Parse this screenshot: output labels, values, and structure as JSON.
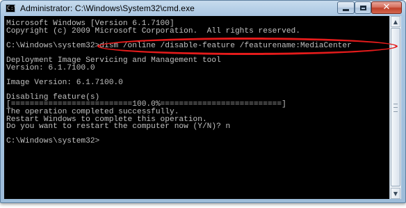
{
  "window": {
    "title": "Administrator: C:\\Windows\\System32\\cmd.exe",
    "icon": "cmd-app-icon",
    "icon_glyph": "C:\\",
    "controls": {
      "minimize": "minimize-icon",
      "maximize": "maximize-icon",
      "close": "close-icon",
      "close_glyph": "✕"
    }
  },
  "console": {
    "lines": [
      "Microsoft Windows [Version 6.1.7100]",
      "Copyright (c) 2009 Microsoft Corporation.  All rights reserved.",
      "",
      "C:\\Windows\\system32>dism /online /disable-feature /featurename:MediaCenter",
      "",
      "Deployment Image Servicing and Management tool",
      "Version: 6.1.7100.0",
      "",
      "Image Version: 6.1.7100.0",
      "",
      "Disabling feature(s)",
      "[==========================100.0%==========================]",
      "The operation completed successfully.",
      "Restart Windows to complete this operation.",
      "Do you want to restart the computer now (Y/N)? n",
      "",
      "C:\\Windows\\system32>"
    ]
  },
  "annotation": {
    "highlight_color": "#e41b1b"
  },
  "scrollbar": {
    "up_glyph": "▲",
    "down_glyph": "▼"
  }
}
